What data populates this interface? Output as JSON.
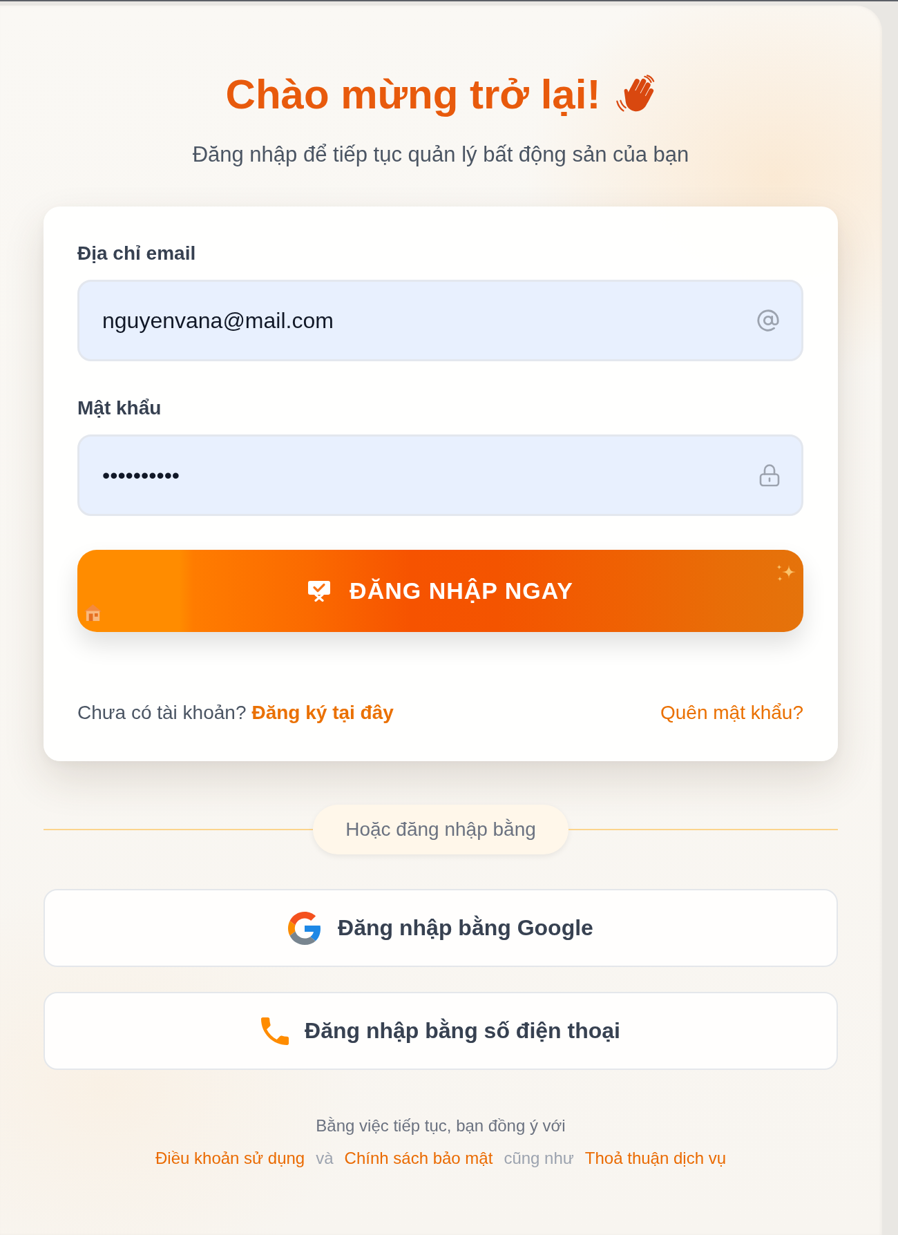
{
  "header": {
    "title": "Chào mừng trở lại!",
    "subtitle": "Đăng nhập để tiếp tục quản lý bất động sản của bạn"
  },
  "login_form": {
    "fields": [
      {
        "kind": "email",
        "label": "Địa chỉ email",
        "value": "nguyenvana@mail.com"
      },
      {
        "kind": "password",
        "label": "Mật khẩu",
        "value": "••••••••••"
      }
    ],
    "submit_button": {
      "label": "ĐĂNG NHẬP NGAY"
    },
    "signup_prompt": "Chưa có tài khoản?",
    "signup_link": "Đăng ký tại đây",
    "forgot_password_link": "Quên mật khẩu?"
  },
  "divider": {
    "label": "Hoặc đăng nhập bằng"
  },
  "social_logins": [
    {
      "kind": "google",
      "label": "Đăng nhập bằng Google"
    },
    {
      "kind": "phone",
      "label": "Đăng nhập bằng số điện thoại"
    }
  ],
  "footer": {
    "intro": "Bằng việc tiếp tục, bạn đồng ý với",
    "items": [
      {
        "kind": "link",
        "text": "Điều khoản sử dụng"
      },
      {
        "kind": "text",
        "text": "và"
      },
      {
        "kind": "link",
        "text": "Chính sách bảo mật"
      },
      {
        "kind": "text",
        "text": "cũng như"
      },
      {
        "kind": "link",
        "text": "Thoả thuận dịch vụ"
      }
    ]
  }
}
